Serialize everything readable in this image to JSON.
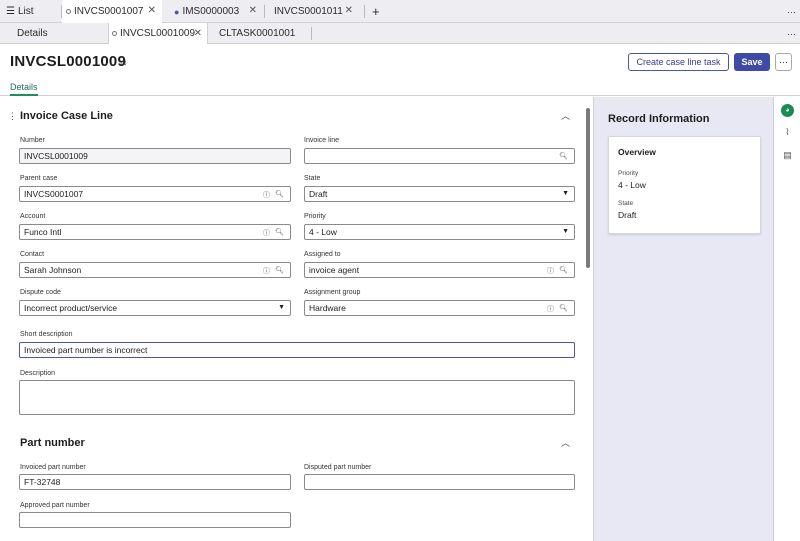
{
  "tabs": [
    {
      "label": "List",
      "icon": "list-icon"
    },
    {
      "label": "INVCS0001007"
    },
    {
      "label": "IMS0000003",
      "icon": "chat-icon"
    },
    {
      "label": "INVCS0001011"
    }
  ],
  "subtabs": [
    {
      "label": "Details"
    },
    {
      "label": "INVCSL0001009"
    },
    {
      "label": "CLTASK0001001"
    }
  ],
  "header": {
    "title": "INVCSL0001009",
    "create_task_label": "Create case line task",
    "save_label": "Save",
    "more_label": "···",
    "details_tab": "Details"
  },
  "section1": {
    "title": "Invoice Case Line",
    "fields": {
      "number": {
        "label": "Number",
        "value": "INVCSL0001009"
      },
      "invoice_line": {
        "label": "Invoice line",
        "value": ""
      },
      "parent_case": {
        "label": "Parent case",
        "value": "INVCS0001007"
      },
      "state": {
        "label": "State",
        "value": "Draft"
      },
      "account": {
        "label": "Account",
        "value": "Funco Intl"
      },
      "priority": {
        "label": "Priority",
        "value": "4 - Low"
      },
      "contact": {
        "label": "Contact",
        "value": "Sarah Johnson"
      },
      "assigned_to": {
        "label": "Assigned to",
        "value": "invoice agent"
      },
      "dispute_code": {
        "label": "Dispute code",
        "value": "Incorrect product/service"
      },
      "assignment_group": {
        "label": "Assignment group",
        "value": "Hardware"
      },
      "short_description": {
        "label": "Short description",
        "value": "Invoiced part number is incorrect"
      },
      "description": {
        "label": "Description",
        "value": ""
      }
    }
  },
  "section2": {
    "title": "Part number",
    "fields": {
      "invoiced_part": {
        "label": "Invoiced part number",
        "value": "FT-32748"
      },
      "disputed_part": {
        "label": "Disputed part number",
        "value": ""
      },
      "approved_part": {
        "label": "Approved part number",
        "value": ""
      }
    }
  },
  "record_info": {
    "title": "Record Information",
    "card_title": "Overview",
    "priority_label": "Priority",
    "priority_value": "4 - Low",
    "state_label": "State",
    "state_value": "Draft"
  },
  "colors": {
    "accent": "#3e4aa5",
    "green": "#1c8a57",
    "panel": "#e8e8f4"
  }
}
